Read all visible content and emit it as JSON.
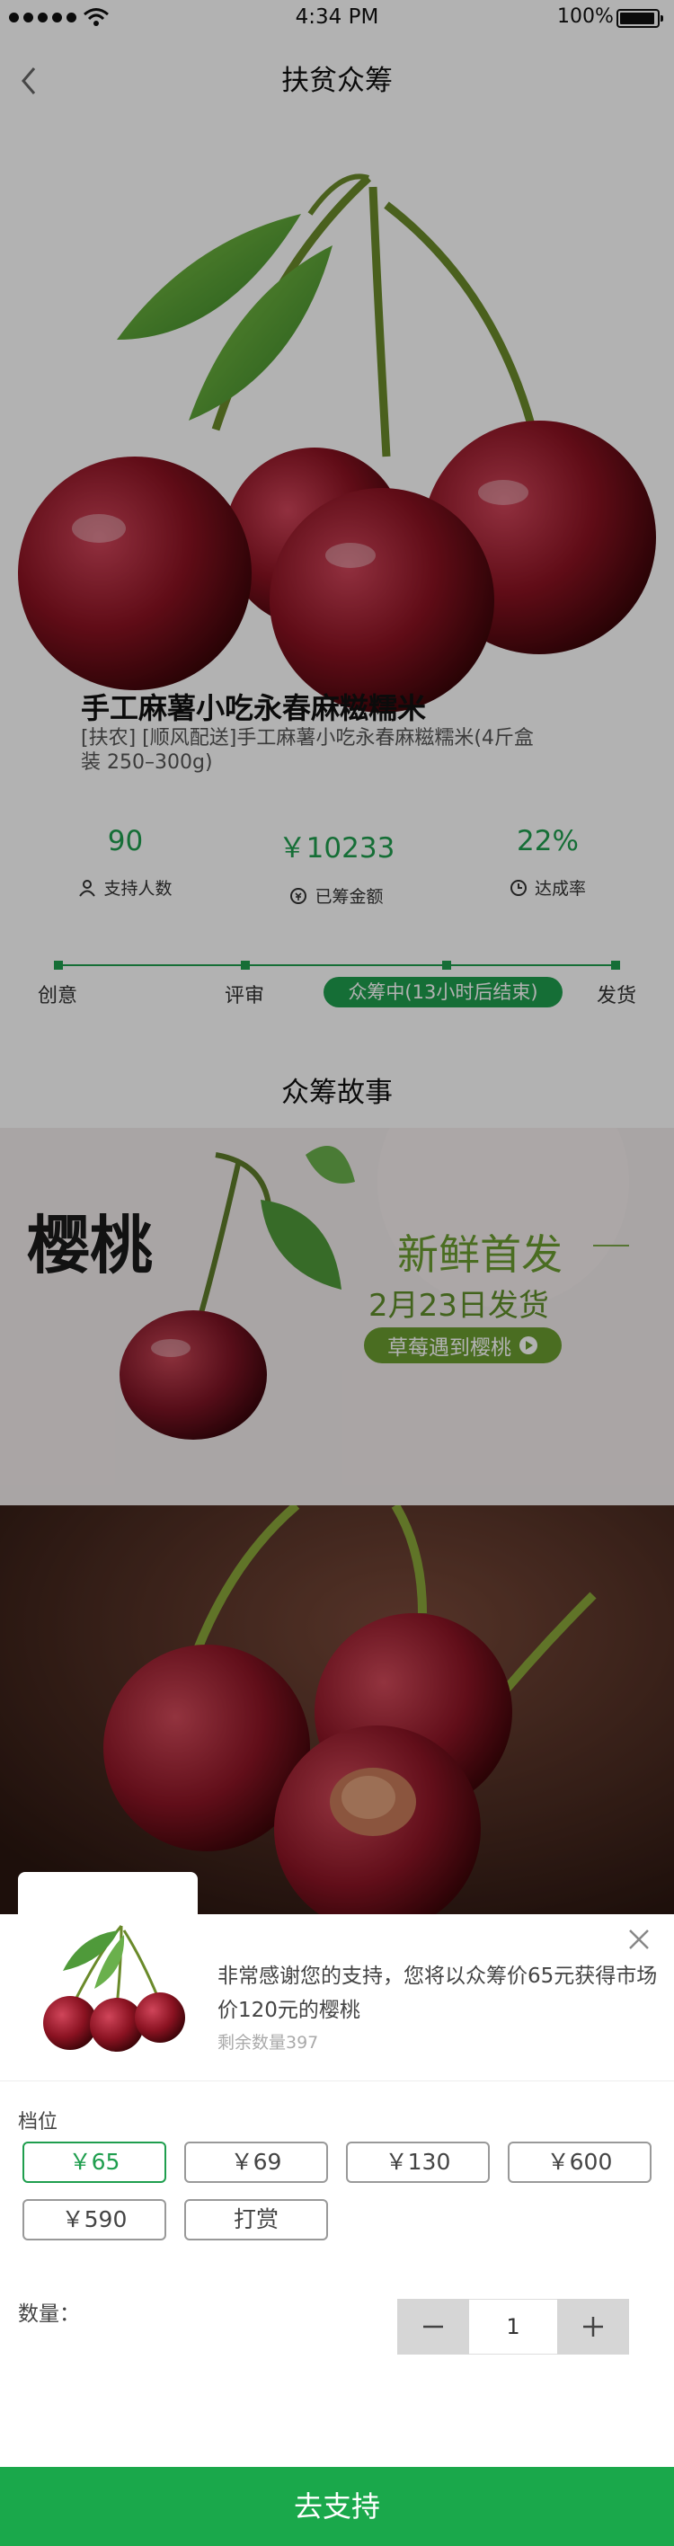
{
  "status_bar": {
    "time": "4:34 PM",
    "battery": "100%"
  },
  "nav": {
    "title": "扶贫众筹"
  },
  "product": {
    "title": "手工麻薯小吃永春麻糍糯米",
    "description": "[扶农] [顺风配送]手工麻薯小吃永春麻糍糯米(4斤盒装 250–300g)"
  },
  "stats": [
    {
      "value": "90",
      "label": "支持人数",
      "icon": "person-icon"
    },
    {
      "value": "￥10233",
      "label": "已筹金额",
      "icon": "money-icon"
    },
    {
      "value": "22%",
      "label": "达成率",
      "icon": "clock-icon"
    }
  ],
  "progress": {
    "steps": [
      "创意",
      "评审",
      "众筹中(13小时后结束)",
      "发货"
    ]
  },
  "story": {
    "title": "众筹故事"
  },
  "banner": {
    "logo_text": "樱桃",
    "headline": "新鲜首发",
    "date_line": "2月23日发货",
    "pill": "草莓遇到樱桃"
  },
  "sheet": {
    "description": "非常感谢您的支持，您将以众筹价65元获得市场价120元的樱桃",
    "remaining": "剩余数量397",
    "tier_label": "档位",
    "options": [
      "￥65",
      "￥69",
      "￥130",
      "￥600",
      "￥590",
      "打赏"
    ],
    "selected_option": "￥65",
    "quantity_label": "数量：",
    "quantity": "1",
    "submit_label": "去支持"
  },
  "colors": {
    "accent": "#1f9e4e",
    "button": "#1aa84b"
  }
}
